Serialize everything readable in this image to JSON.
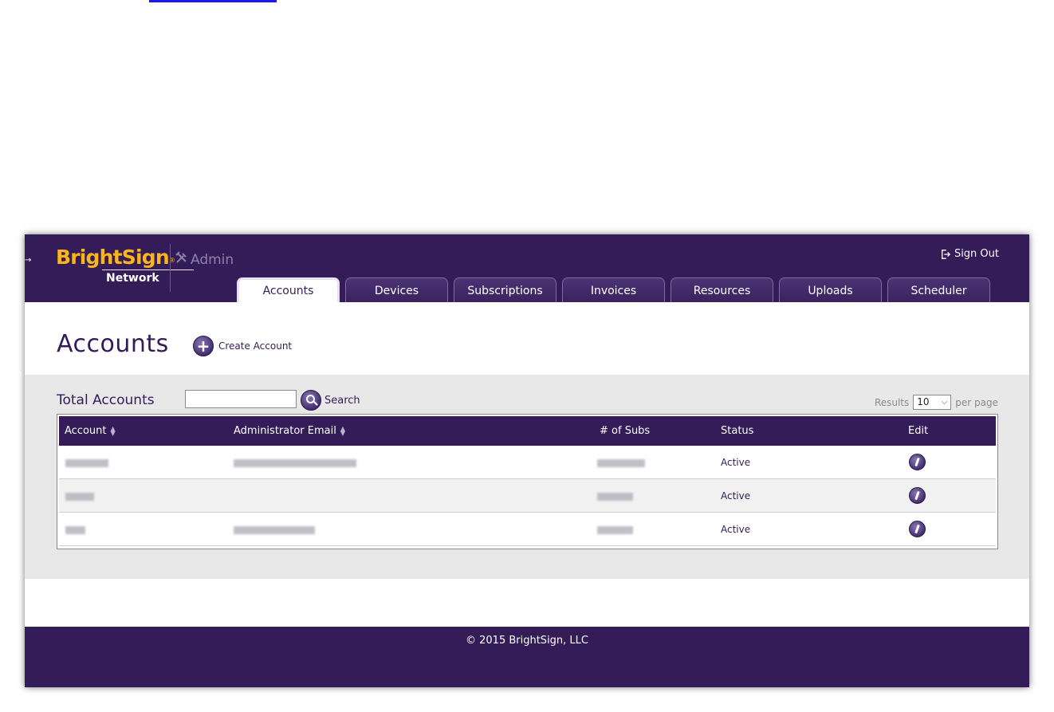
{
  "header": {
    "logo_text": "BrightSign",
    "logo_reg": "®",
    "logo_sub": "Network",
    "admin_label": "Admin",
    "signout_label": "Sign Out"
  },
  "tabs": [
    {
      "label": "Accounts",
      "active": true
    },
    {
      "label": "Devices",
      "active": false
    },
    {
      "label": "Subscriptions",
      "active": false
    },
    {
      "label": "Invoices",
      "active": false
    },
    {
      "label": "Resources",
      "active": false
    },
    {
      "label": "Uploads",
      "active": false
    },
    {
      "label": "Scheduler",
      "active": false
    }
  ],
  "page": {
    "title": "Accounts",
    "create_label": "Create Account"
  },
  "toolbar": {
    "total_label": "Total Accounts",
    "search_value": "",
    "search_label": "Search",
    "results_label": "Results",
    "results_value": "10",
    "per_page_label": "per page"
  },
  "table": {
    "columns": [
      "Account",
      "Administrator Email",
      "# of Subs",
      "Status",
      "Edit"
    ],
    "rows": [
      {
        "account": "",
        "email": "",
        "subs": "",
        "status": "Active"
      },
      {
        "account": "",
        "email": "",
        "subs": "",
        "status": "Active"
      },
      {
        "account": "",
        "email": "",
        "subs": "",
        "status": "Active"
      }
    ]
  },
  "footer": {
    "copyright": "© 2015 BrightSign, LLC"
  },
  "colors": {
    "brand_purple": "#331c57",
    "logo_yellow": "#f8b51c",
    "panel_grey": "#e8e8e8"
  },
  "icons": [
    "wrench-icon",
    "sign-out-icon",
    "plus-icon",
    "search-icon",
    "sort-icon",
    "edit-icon"
  ]
}
